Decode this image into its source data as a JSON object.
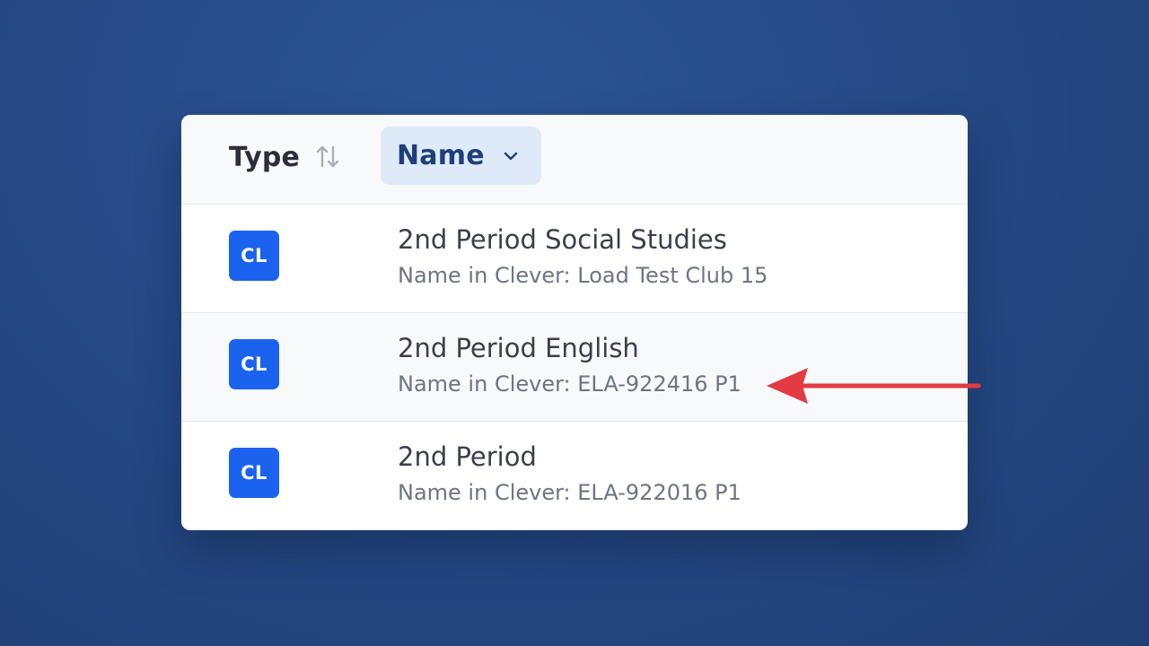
{
  "table": {
    "header": {
      "type_label": "Type",
      "name_label": "Name",
      "type_sort_icon": "sort-arrows-icon",
      "name_sort_icon": "chevron-down-icon"
    },
    "rows": [
      {
        "badge": "CL",
        "title": "2nd Period Social Studies",
        "subtitle": "Name in Clever: Load Test Club 15"
      },
      {
        "badge": "CL",
        "title": "2nd Period English",
        "subtitle": "Name in Clever: ELA-922416 P1"
      },
      {
        "badge": "CL",
        "title": "2nd Period",
        "subtitle": "Name in Clever: ELA-922016 P1"
      }
    ]
  },
  "annotation": {
    "icon": "red-arrow-icon",
    "color": "#e23b44"
  },
  "colors": {
    "badge": "#1b63ee",
    "active_header_bg": "#dfeaf8",
    "active_header_text": "#1f3f7a"
  }
}
